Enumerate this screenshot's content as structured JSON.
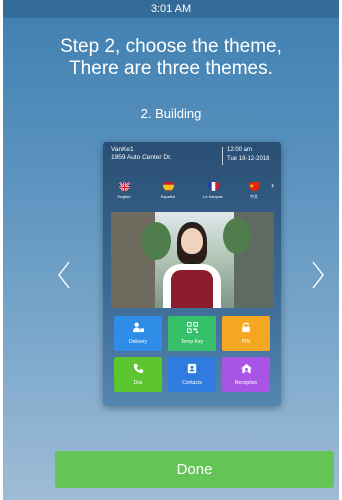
{
  "status_bar": {
    "time": "3:01 AM"
  },
  "heading": {
    "line1": "Step 2, choose the theme,",
    "line2": "There are three themes."
  },
  "theme": {
    "label": "2. Building"
  },
  "preview": {
    "company": "VanKe1",
    "address": "1959 Auto Center Dr.",
    "time": "12:00 am",
    "date": "Tue 18-12-2018",
    "languages": [
      {
        "label": "English",
        "icon": "uk-flag-icon"
      },
      {
        "label": "Español",
        "icon": "spain-flag-icon"
      },
      {
        "label": "Le français",
        "icon": "france-flag-icon"
      },
      {
        "label": "中文",
        "icon": "china-flag-icon"
      }
    ],
    "tiles": [
      {
        "label": "Delivery",
        "color": "#2f8de8",
        "icon": "delivery-icon"
      },
      {
        "label": "Temp Key",
        "color": "#36c06a",
        "icon": "qr-code-icon"
      },
      {
        "label": "PIN",
        "color": "#f5a623",
        "icon": "lock-icon"
      },
      {
        "label": "Dial",
        "color": "#5cc530",
        "icon": "phone-icon"
      },
      {
        "label": "Contacts",
        "color": "#2f7be0",
        "icon": "contacts-icon"
      },
      {
        "label": "Reception",
        "color": "#a855e6",
        "icon": "reception-icon"
      }
    ]
  },
  "navigation": {
    "prev_icon": "chevron-left-icon",
    "next_icon": "chevron-right-icon"
  },
  "done_button": {
    "label": "Done",
    "color": "#64c556"
  }
}
